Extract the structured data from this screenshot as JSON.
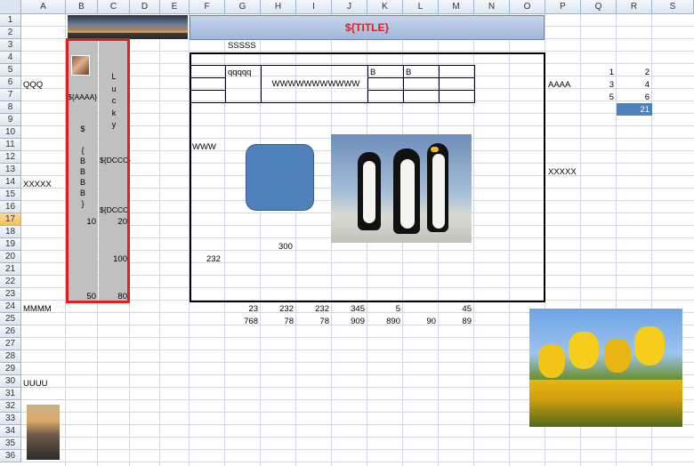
{
  "columns": [
    "A",
    "B",
    "C",
    "D",
    "E",
    "F",
    "G",
    "H",
    "I",
    "J",
    "K",
    "L",
    "M",
    "N",
    "O",
    "P",
    "Q",
    "R",
    "S"
  ],
  "rows": [
    "1",
    "2",
    "3",
    "4",
    "5",
    "6",
    "7",
    "8",
    "9",
    "10",
    "11",
    "12",
    "13",
    "14",
    "15",
    "16",
    "17",
    "18",
    "19",
    "20",
    "21",
    "22",
    "23",
    "24",
    "25",
    "26",
    "27",
    "28",
    "29",
    "30",
    "31",
    "32",
    "33",
    "34",
    "35",
    "36"
  ],
  "selected_row": "17",
  "title": "${TITLE}",
  "title_color": "#e02020",
  "accent_blue": "#4f81bd",
  "cells": {
    "g3": "SSSSS",
    "a6": "QQQ",
    "b7": "${AAAA}",
    "c_vert": "L\nu\nc\nk\ny",
    "b_vert": "$\n\n{\nB\nB\nB\nB\n}",
    "c12": "${DCCC}",
    "c16": "${DCCC",
    "b17": "10",
    "c17": "20",
    "c20": "100",
    "b23": "50",
    "c23": "80",
    "a14": "XXXXX",
    "a24": "MMMM",
    "a30": "UUUU",
    "g5": "qqqqq",
    "h6": "WWWWWWWWWWW",
    "k5": "B",
    "l5": "B",
    "f11": "WWW",
    "h19": "300",
    "f20": "232",
    "p6": "AAAA",
    "p13": "XXXXX",
    "q5": "1",
    "r5": "2",
    "q6": "3",
    "r6": "4",
    "q7": "5",
    "r7": "6",
    "r8": "21",
    "row24": [
      "23",
      "232",
      "232",
      "345",
      "5",
      "",
      "45"
    ],
    "row25": [
      "768",
      "78",
      "78",
      "909",
      "890",
      "90",
      "89"
    ]
  },
  "images": [
    "banner-landscape-image",
    "portrait-photo-image",
    "penguins-photo-image",
    "tulips-photo-image",
    "castle-photo-image"
  ],
  "shape": "rounded-rectangle-shape"
}
